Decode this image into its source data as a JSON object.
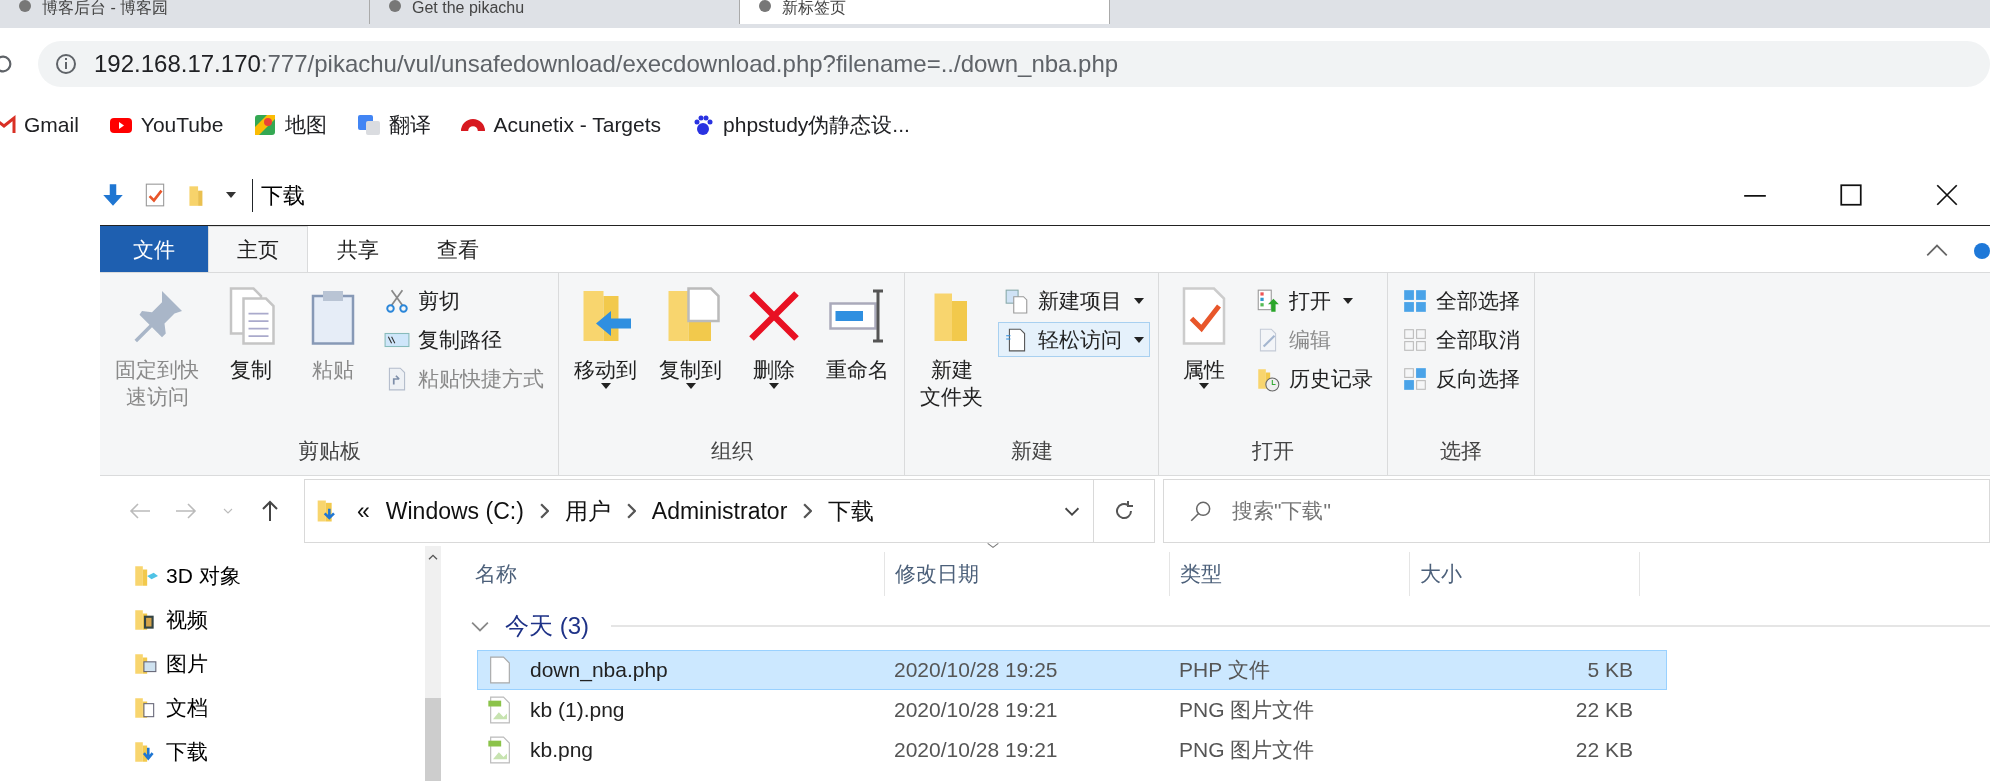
{
  "browser": {
    "tabs": [
      {
        "title": "博客后台 - 博客园",
        "selected": false
      },
      {
        "title": "Get the pikachu",
        "selected": false
      },
      {
        "title": "新标签页",
        "selected": true
      }
    ],
    "address": {
      "host": "192.168.17.170",
      "rest": ":777/pikachu/vul/unsafedownload/execdownload.php?filename=../down_nba.php"
    },
    "bookmarks": [
      {
        "label": "Gmail"
      },
      {
        "label": "YouTube"
      },
      {
        "label": "地图"
      },
      {
        "label": "翻译"
      },
      {
        "label": "Acunetix - Targets"
      },
      {
        "label": "phpstudy伪静态设..."
      }
    ]
  },
  "explorer": {
    "title": "下载",
    "ribbon_tabs": [
      {
        "label": "文件",
        "kind": "file",
        "selected": false
      },
      {
        "label": "主页",
        "kind": "tab",
        "selected": true
      },
      {
        "label": "共享",
        "kind": "tab",
        "selected": false
      },
      {
        "label": "查看",
        "kind": "tab",
        "selected": false
      }
    ],
    "ribbon_groups": [
      {
        "label": "剪贴板",
        "columns": [
          {
            "kind": "large",
            "label": [
              "固定到快",
              "速访问"
            ],
            "disabled": true,
            "dropdown": false,
            "highlighted": false
          },
          {
            "kind": "large",
            "label": [
              "复制"
            ],
            "disabled": false,
            "dropdown": false,
            "highlighted": false
          },
          {
            "kind": "large",
            "label": [
              "粘贴"
            ],
            "disabled": true,
            "dropdown": false,
            "highlighted": false
          },
          {
            "kind": "stack",
            "items": [
              {
                "label": "剪切",
                "disabled": false,
                "dropdown": false,
                "highlighted": false
              },
              {
                "label": "复制路径",
                "disabled": false,
                "dropdown": false,
                "highlighted": false
              },
              {
                "label": "粘贴快捷方式",
                "disabled": true,
                "dropdown": false,
                "highlighted": false
              }
            ]
          }
        ]
      },
      {
        "label": "组织",
        "columns": [
          {
            "kind": "large",
            "label": [
              "移动到"
            ],
            "disabled": false,
            "dropdown": true,
            "highlighted": false
          },
          {
            "kind": "large",
            "label": [
              "复制到"
            ],
            "disabled": false,
            "dropdown": true,
            "highlighted": false
          },
          {
            "kind": "large",
            "label": [
              "删除"
            ],
            "disabled": false,
            "dropdown": true,
            "highlighted": false
          },
          {
            "kind": "large",
            "label": [
              "重命名"
            ],
            "disabled": false,
            "dropdown": false,
            "highlighted": false
          }
        ]
      },
      {
        "label": "新建",
        "columns": [
          {
            "kind": "large",
            "label": [
              "新建",
              "文件夹"
            ],
            "disabled": false,
            "dropdown": false,
            "highlighted": false
          },
          {
            "kind": "stack",
            "items": [
              {
                "label": "新建项目",
                "disabled": false,
                "dropdown": true,
                "highlighted": false
              },
              {
                "label": "轻松访问",
                "disabled": false,
                "dropdown": true,
                "highlighted": true
              }
            ]
          }
        ]
      },
      {
        "label": "打开",
        "columns": [
          {
            "kind": "large",
            "label": [
              "属性"
            ],
            "disabled": false,
            "dropdown": true,
            "highlighted": false
          },
          {
            "kind": "stack",
            "items": [
              {
                "label": "打开",
                "disabled": false,
                "dropdown": true,
                "highlighted": false
              },
              {
                "label": "编辑",
                "disabled": true,
                "dropdown": false,
                "highlighted": false
              },
              {
                "label": "历史记录",
                "disabled": false,
                "dropdown": false,
                "highlighted": false
              }
            ]
          }
        ]
      },
      {
        "label": "选择",
        "columns": [
          {
            "kind": "stack",
            "items": [
              {
                "label": "全部选择",
                "disabled": false,
                "dropdown": false,
                "highlighted": false
              },
              {
                "label": "全部取消",
                "disabled": false,
                "dropdown": false,
                "highlighted": false
              },
              {
                "label": "反向选择",
                "disabled": false,
                "dropdown": false,
                "highlighted": false
              }
            ]
          }
        ]
      }
    ],
    "breadcrumb_overflow": "«",
    "breadcrumb": [
      "Windows (C:)",
      "用户",
      "Administrator",
      "下载"
    ],
    "search": {
      "placeholder": "搜索\"下载\""
    },
    "nav_items": [
      {
        "label": "3D 对象"
      },
      {
        "label": "视频"
      },
      {
        "label": "图片"
      },
      {
        "label": "文档"
      },
      {
        "label": "下载"
      }
    ],
    "columns": [
      "名称",
      "修改日期",
      "类型",
      "大小"
    ],
    "groups": [
      {
        "label": "今天 (3)",
        "expanded": true,
        "rows": [
          {
            "kind": "file",
            "name": "down_nba.php",
            "date": "2020/10/28 19:25",
            "type": "PHP 文件",
            "size": "5 KB",
            "selected": true
          },
          {
            "kind": "image",
            "name": "kb (1).png",
            "date": "2020/10/28 19:21",
            "type": "PNG 图片文件",
            "size": "22 KB",
            "selected": false
          },
          {
            "kind": "image",
            "name": "kb.png",
            "date": "2020/10/28 19:21",
            "type": "PNG 图片文件",
            "size": "22 KB",
            "selected": false
          }
        ]
      }
    ]
  }
}
